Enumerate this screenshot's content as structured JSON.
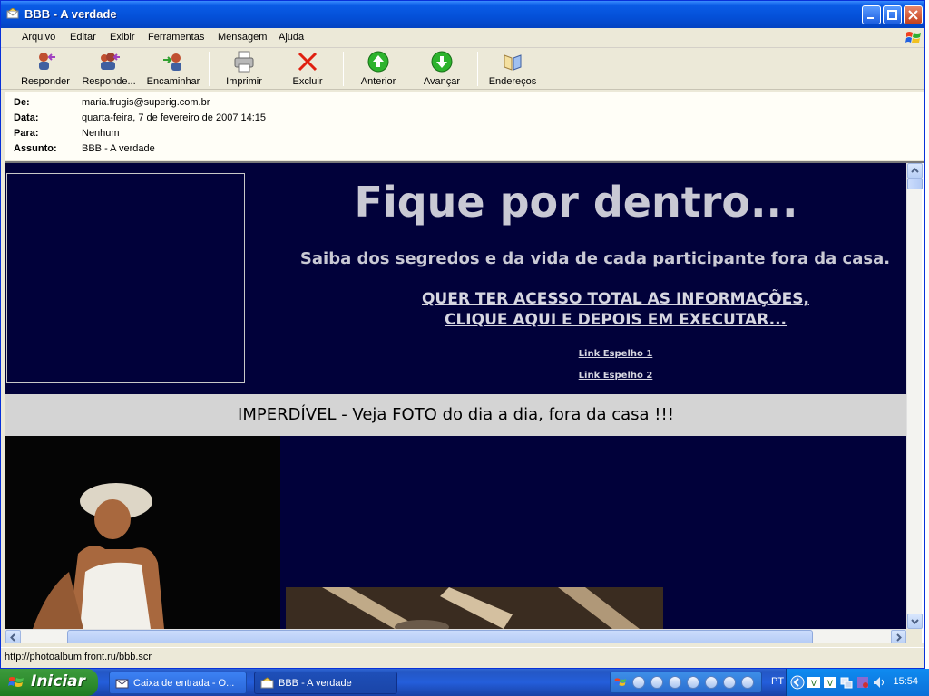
{
  "window": {
    "title": "BBB - A verdade"
  },
  "menu": [
    "Arquivo",
    "Editar",
    "Exibir",
    "Ferramentas",
    "Mensagem",
    "Ajuda"
  ],
  "toolbar": {
    "reply": "Responder",
    "reply_all": "Responde...",
    "forward": "Encaminhar",
    "print": "Imprimir",
    "delete": "Excluir",
    "previous": "Anterior",
    "next": "Avançar",
    "addresses": "Endereços"
  },
  "header": {
    "from_label": "De:",
    "from_value": "maria.frugis@superig.com.br",
    "date_label": "Data:",
    "date_value": "quarta-feira, 7 de fevereiro de 2007 14:15",
    "to_label": "Para:",
    "to_value": "Nenhum",
    "subject_label": "Assunto:",
    "subject_value": "BBB - A verdade"
  },
  "message": {
    "headline": "Fique por dentro...",
    "subline": "Saiba dos segredos e da vida de cada participante fora da casa.",
    "cta_line1": "QUER TER ACESSO TOTAL AS INFORMAÇÕES,",
    "cta_line2": "CLIQUE AQUI E DEPOIS EM EXECUTAR...",
    "link1": "Link Espelho 1",
    "link2": "Link Espelho 2",
    "banner": "IMPERDÍVEL - Veja FOTO do dia a dia, fora da casa !!!"
  },
  "status": {
    "text": "http://photoalbum.front.ru/bbb.scr"
  },
  "taskbar": {
    "start": "Iniciar",
    "item1": "Caixa de entrada - O...",
    "item2": "BBB - A verdade",
    "lang": "PT",
    "clock": "15:54"
  },
  "colors": {
    "message_bg": "#01013a",
    "banner_bg": "#d4d4d4",
    "title_blue": "#0450d8"
  }
}
